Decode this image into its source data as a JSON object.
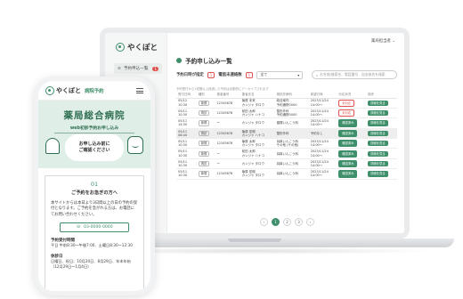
{
  "brand": {
    "name": "やくぽと",
    "phone_suffix": "病院予約",
    "accent": "#3e8f6a",
    "alert": "#e0524f"
  },
  "desktop": {
    "sidebar": {
      "item_label": "予約申込一覧",
      "badge": "1"
    },
    "topbar": {
      "user_menu": "薬局担当者 ⌄"
    },
    "title": "予約申し込み一覧",
    "filters": {
      "status_label": "予約日時が指定",
      "status_count": "1",
      "unconfirmed_label": "電話未連絡数",
      "unconfirmed_count": "1",
      "sort_value": "全て",
      "search_placeholder": "お名前/検索名、電話番号、自治体名を検索"
    },
    "note": "予約受付から1週間以上経過した予約は自動的にアーカイブされます",
    "table": {
      "headers": [
        "受付日時",
        "種別",
        "患者番号",
        "患者氏名",
        "検診診療科",
        "希望日時",
        "対応状況",
        "操作"
      ],
      "rows": [
        {
          "date": "05/12",
          "time": "10:30",
          "type": "新規",
          "id": "12345678",
          "name": "篠原 未来",
          "kana": "カンジャ タロウ",
          "dept": "総合案内",
          "dept2": "予約通院0000",
          "wish": "2023/11/24",
          "wish2": "14:00〜",
          "status": "未対応",
          "status_style": "red",
          "action": "詳細を見る",
          "hl": false
        },
        {
          "date": "05/11",
          "time": "10:30",
          "type": "再診",
          "id": "12345678",
          "name": "前田 太郎",
          "kana": "カンジャ ハナコ",
          "dept": "整形外科",
          "dept2": "予約通院0000",
          "wish": "2023/11/24",
          "wish2": "14:00〜",
          "status": "未対応",
          "status_style": "red",
          "action": "詳細を見る",
          "hl": false
        },
        {
          "date": "05/11",
          "time": "14:30",
          "type": "新規",
          "id": "ー",
          "name": "カンジャ タロウ",
          "kana": "",
          "dept": "循環いんこう科",
          "dept2": "",
          "wish": "2023/11/24",
          "wish2": "14:00〜",
          "status": "確認済み",
          "status_style": "green",
          "action": "詳細を見る",
          "hl": false
        },
        {
          "date": "05/11",
          "time": "08:40",
          "type": "再診",
          "id": "12345678",
          "name": "篠原 宏樹",
          "kana": "カンジャ ハナコ",
          "dept": "整形外科",
          "dept2": "",
          "wish": "予約なし",
          "wish2": "",
          "status": "確認済み",
          "status_style": "green",
          "action": "詳細を見る",
          "hl": true
        },
        {
          "date": "05/11",
          "time": "10:30",
          "type": "新規",
          "id": "12345678",
          "name": "篠原 太郎",
          "kana": "カンジャ タロウ",
          "dept": "耳鼻いんこう科",
          "dept2": "その他 (その他)",
          "wish": "2023/11/24",
          "wish2": "14:00〜",
          "status": "確認済み",
          "status_style": "green",
          "action": "詳細を見る",
          "hl": false
        },
        {
          "date": "05/11",
          "time": "10:30",
          "type": "新規",
          "id": "ー",
          "name": "前田 太郎",
          "kana": "カンジャ ハナコ",
          "dept": "耳鼻いんこう科",
          "dept2": "",
          "wish": "2023/11/24",
          "wish2": "14:00〜",
          "status": "確認済み",
          "status_style": "green",
          "action": "詳細を見る",
          "hl": false
        },
        {
          "date": "05/11",
          "time": "10:30",
          "type": "再診",
          "id": "ー",
          "name": "カンジャ タロウ",
          "kana": "",
          "dept": "耳鼻いんこう科",
          "dept2": "",
          "wish": "2023/11/24",
          "wish2": "14:00〜",
          "status": "確認済み",
          "status_style": "green",
          "action": "詳細を見る",
          "hl": false
        },
        {
          "date": "05/11",
          "time": "10:30",
          "type": "新規",
          "id": "12345678",
          "name": "篠原 宏樹",
          "kana": "カンジャ タロウ",
          "dept": "耳鼻いんこう科",
          "dept2": "",
          "wish": "2023/11/24",
          "wish2": "14:00〜",
          "status": "確認済み",
          "status_style": "green",
          "action": "詳細を見る",
          "hl": false
        }
      ]
    },
    "pager": [
      "‹",
      "1",
      "2",
      "3",
      "›"
    ],
    "pager_active": "1"
  },
  "mobile": {
    "hospital": "薬局総合病院",
    "hero_sub": "web初診予約お申し込み",
    "bubble_1": "お申し込み前に",
    "bubble_2": "ご確認ください",
    "step_num": "01",
    "step_title": "ご予約をお急ぎの方へ",
    "step_body": "本サイトからは本日より3日間以上の日の予約の受付となります。ご予約を急がれる方は、お電話にてお問い合わせください。",
    "tel": "03-0000-0000",
    "hours_head": "予約受付時間",
    "hours_body": "平日 午前8:30〜午後7:00、土曜日8:30〜12:30",
    "closed_head": "休診日",
    "closed_body": "日曜日、祝日、10月20日、8月29日、年末年始（12月29日〜1月4日）"
  }
}
